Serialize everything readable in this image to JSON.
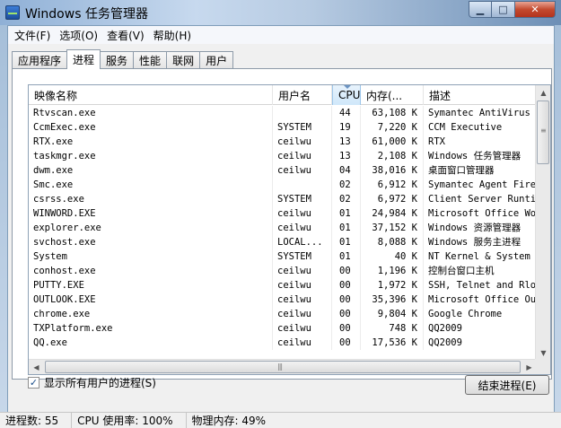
{
  "window": {
    "title": "Windows 任务管理器"
  },
  "menu": [
    "文件(F)",
    "选项(O)",
    "查看(V)",
    "帮助(H)"
  ],
  "tabs": [
    "应用程序",
    "进程",
    "服务",
    "性能",
    "联网",
    "用户"
  ],
  "active_tab": 1,
  "columns": [
    "映像名称",
    "用户名",
    "CPU",
    "内存(...",
    "描述"
  ],
  "processes": [
    {
      "image": "Rtvscan.exe",
      "user": "",
      "cpu": "44",
      "mem": "63,108 K",
      "desc": "Symantec AntiVirus"
    },
    {
      "image": "CcmExec.exe",
      "user": "SYSTEM",
      "cpu": "19",
      "mem": "7,220 K",
      "desc": "CCM Executive"
    },
    {
      "image": "RTX.exe",
      "user": "ceilwu",
      "cpu": "13",
      "mem": "61,000 K",
      "desc": "RTX"
    },
    {
      "image": "taskmgr.exe",
      "user": "ceilwu",
      "cpu": "13",
      "mem": "2,108 K",
      "desc": "Windows 任务管理器"
    },
    {
      "image": "dwm.exe",
      "user": "ceilwu",
      "cpu": "04",
      "mem": "38,016 K",
      "desc": "桌面窗口管理器"
    },
    {
      "image": "Smc.exe",
      "user": "",
      "cpu": "02",
      "mem": "6,912 K",
      "desc": "Symantec Agent Fire."
    },
    {
      "image": "csrss.exe",
      "user": "SYSTEM",
      "cpu": "02",
      "mem": "6,972 K",
      "desc": "Client Server Runti."
    },
    {
      "image": "WINWORD.EXE",
      "user": "ceilwu",
      "cpu": "01",
      "mem": "24,984 K",
      "desc": "Microsoft Office Wor"
    },
    {
      "image": "explorer.exe",
      "user": "ceilwu",
      "cpu": "01",
      "mem": "37,152 K",
      "desc": "Windows 资源管理器"
    },
    {
      "image": "svchost.exe",
      "user": "LOCAL...",
      "cpu": "01",
      "mem": "8,088 K",
      "desc": "Windows 服务主进程"
    },
    {
      "image": "System",
      "user": "SYSTEM",
      "cpu": "01",
      "mem": "40 K",
      "desc": "NT Kernel & System"
    },
    {
      "image": "conhost.exe",
      "user": "ceilwu",
      "cpu": "00",
      "mem": "1,196 K",
      "desc": "控制台窗口主机"
    },
    {
      "image": "PUTTY.EXE",
      "user": "ceilwu",
      "cpu": "00",
      "mem": "1,972 K",
      "desc": "SSH, Telnet and Rlo."
    },
    {
      "image": "OUTLOOK.EXE",
      "user": "ceilwu",
      "cpu": "00",
      "mem": "35,396 K",
      "desc": "Microsoft Office Ou."
    },
    {
      "image": "chrome.exe",
      "user": "ceilwu",
      "cpu": "00",
      "mem": "9,804 K",
      "desc": "Google Chrome"
    },
    {
      "image": "TXPlatform.exe",
      "user": "ceilwu",
      "cpu": "00",
      "mem": "748 K",
      "desc": "QQ2009"
    },
    {
      "image": "QQ.exe",
      "user": "ceilwu",
      "cpu": "00",
      "mem": "17,536 K",
      "desc": "QQ2009"
    }
  ],
  "show_all_users": {
    "label": "显示所有用户的进程(S)",
    "checked": true
  },
  "end_process_label": "结束进程(E)",
  "status": {
    "processes": "进程数: 55",
    "cpu": "CPU 使用率: 100%",
    "memory": "物理内存: 49%"
  }
}
